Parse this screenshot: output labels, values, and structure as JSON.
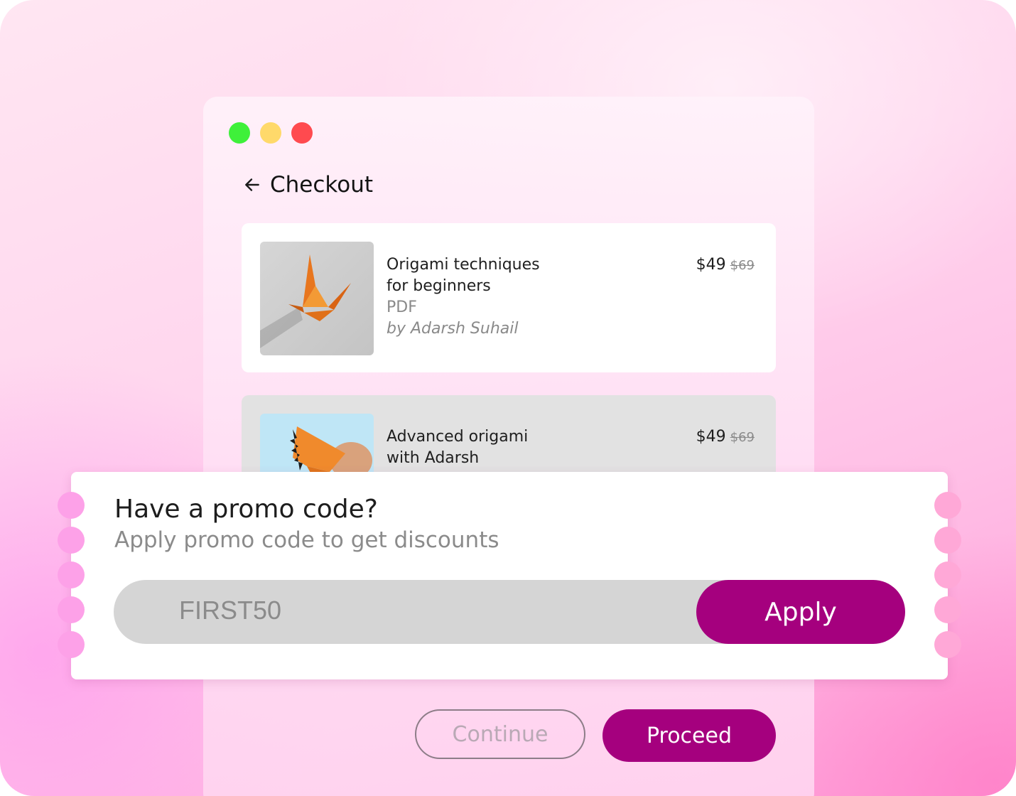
{
  "header": {
    "title": "Checkout",
    "back_icon": "arrow-left-icon"
  },
  "window_controls": [
    {
      "name": "green",
      "color": "#3ff03a"
    },
    {
      "name": "yellow",
      "color": "#ffd96a"
    },
    {
      "name": "red",
      "color": "#ff4a4f"
    }
  ],
  "products": [
    {
      "title_line1": "Origami techniques",
      "title_line2": "for beginners",
      "format": "PDF",
      "author": "by Adarsh Suhail",
      "price": "$49",
      "old_price": "$69",
      "thumbnail": "origami-crane-image"
    },
    {
      "title_line1": "Advanced origami",
      "title_line2": "with Adarsh",
      "price": "$49",
      "old_price": "$69",
      "thumbnail": "origami-dragon-image"
    }
  ],
  "promo": {
    "title": "Have a promo code?",
    "subtitle": "Apply promo code to get discounts",
    "code_value": "FIRST50",
    "apply_label": "Apply"
  },
  "actions": {
    "continue_label": "Continue",
    "proceed_label": "Proceed"
  },
  "colors": {
    "accent": "#a5007e",
    "background": "#ffc9ea"
  }
}
